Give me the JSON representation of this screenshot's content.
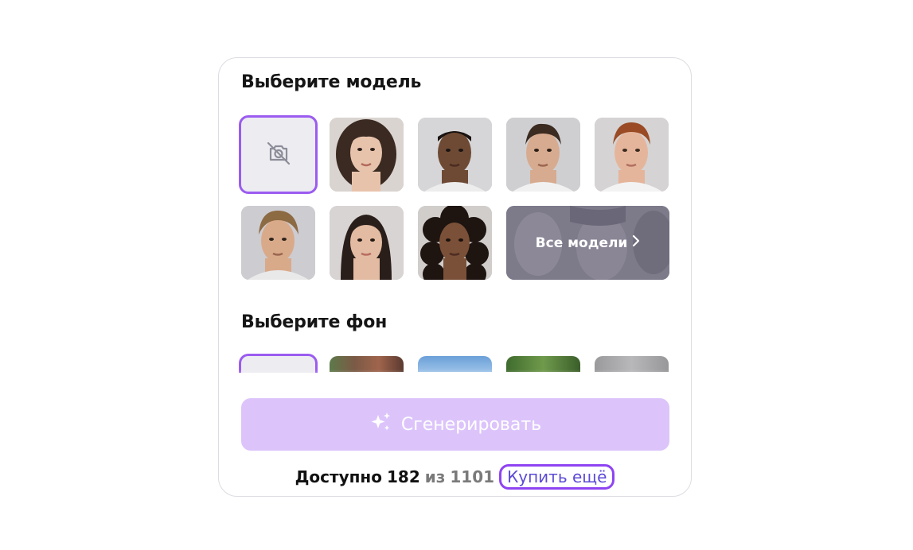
{
  "model_section": {
    "title": "Выберите модель",
    "models": [
      {
        "name": "no-model",
        "selected": true,
        "icon": "camera-off-icon"
      },
      {
        "name": "model-woman-wavy-hair",
        "hair": "#3a2a22",
        "skin": "#e8c3ac",
        "bg": "#d9d4cf"
      },
      {
        "name": "model-man-dark-skin",
        "hair": "#1a1412",
        "skin": "#6e4a34",
        "bg": "#d6d6d8"
      },
      {
        "name": "model-man-brown-hair",
        "hair": "#3b2b20",
        "skin": "#d7ab8f",
        "bg": "#cfcfd2"
      },
      {
        "name": "model-man-red-hair",
        "hair": "#9a4a24",
        "skin": "#e5b59b",
        "bg": "#d5d3d3"
      },
      {
        "name": "model-man-blond-hair",
        "hair": "#8c6a42",
        "skin": "#d9aa8a",
        "bg": "#cdccd1"
      },
      {
        "name": "model-woman-dark-hair",
        "hair": "#2a1e1a",
        "skin": "#e3bba2",
        "bg": "#d8d4d3"
      },
      {
        "name": "model-woman-curly-hair",
        "hair": "#1e1410",
        "skin": "#7a5038",
        "bg": "#d0cdcb"
      }
    ],
    "all_models_label": "Все модели",
    "chevron_icon": "chevron-right-icon"
  },
  "background_section": {
    "title": "Выберите фон",
    "backgrounds": [
      {
        "name": "no-background",
        "color": "#ececf1",
        "selected": true
      },
      {
        "name": "background-trees",
        "color": "#6b5a48"
      },
      {
        "name": "background-sky",
        "color": "#8ab4df"
      },
      {
        "name": "background-greenery",
        "color": "#4f7a3a"
      },
      {
        "name": "background-grey",
        "color": "#a7a7a9"
      }
    ]
  },
  "generate_button": {
    "label": "Сгенерировать",
    "icon": "sparkles-icon",
    "color": "#dcc4fb"
  },
  "footer": {
    "available_label": "Доступно",
    "available_count": "182",
    "of_label": "из",
    "total": "1101",
    "buy_more_label": "Купить ещё"
  },
  "colors": {
    "accent": "#9b5cf0",
    "link": "#5b4bd6"
  }
}
